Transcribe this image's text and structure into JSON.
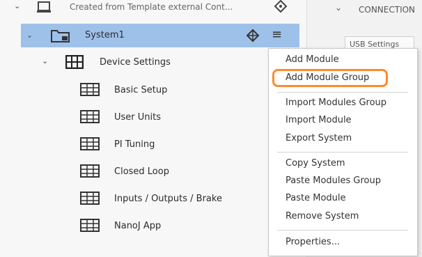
{
  "tree": {
    "top_item": "Created from Template external Cont...",
    "system": "System1",
    "device_settings": "Device Settings",
    "children": [
      {
        "label": "Basic Setup"
      },
      {
        "label": "User Units"
      },
      {
        "label": "PI Tuning"
      },
      {
        "label": "Closed Loop"
      },
      {
        "label": "Inputs / Outputs / Brake"
      },
      {
        "label": "NanoJ App"
      }
    ]
  },
  "right_panel": {
    "header": "CONNECTION",
    "tab": "USB Settings"
  },
  "context_menu": {
    "items": [
      {
        "label": "Add Module"
      },
      {
        "label": "Add Module Group"
      },
      {
        "label": "Import Modules Group"
      },
      {
        "label": "Import Module"
      },
      {
        "label": "Export System"
      },
      {
        "label": "Copy System"
      },
      {
        "label": "Paste Modules Group"
      },
      {
        "label": "Paste Module"
      },
      {
        "label": "Remove System"
      },
      {
        "label": "Properties..."
      }
    ]
  },
  "colors": {
    "selection": "#9ec1ea",
    "highlight": "#ff8a2b"
  }
}
